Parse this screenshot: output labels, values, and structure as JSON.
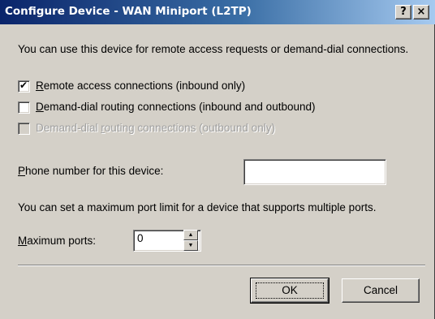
{
  "window": {
    "title": "Configure Device - WAN Miniport (L2TP)",
    "help_button": "?",
    "close_button": "×"
  },
  "intro": "You can use this device for remote access requests or demand-dial connections.",
  "options": [
    {
      "prefix": "",
      "accel": "R",
      "rest": "emote access connections (inbound only)",
      "checked": true,
      "enabled": true
    },
    {
      "prefix": "",
      "accel": "D",
      "rest": "emand-dial routing connections (inbound and outbound)",
      "checked": false,
      "enabled": true
    },
    {
      "prefix": "Demand-dial ",
      "accel": "r",
      "rest": "outing connections (outbound only)",
      "checked": false,
      "enabled": false
    }
  ],
  "phone": {
    "label_accel": "P",
    "label_rest": "hone number for this device:",
    "value": ""
  },
  "ports_note": "You can set a maximum port limit for a device that supports multiple ports.",
  "max_ports": {
    "label_accel": "M",
    "label_rest": "aximum ports:",
    "value": "0"
  },
  "buttons": {
    "ok": "OK",
    "cancel": "Cancel"
  }
}
